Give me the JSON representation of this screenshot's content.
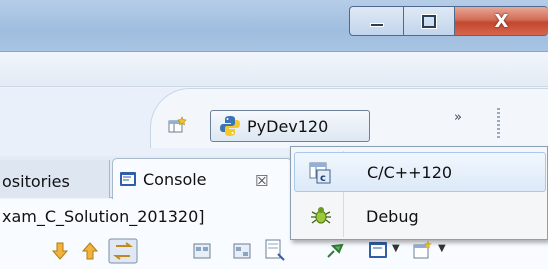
{
  "titlebar": {
    "buttons": [
      {
        "name": "minimize",
        "icon": "minimize-icon"
      },
      {
        "name": "maximize",
        "icon": "restore-icon"
      },
      {
        "name": "close",
        "glyph": "X",
        "color": "#c9503a"
      }
    ]
  },
  "perspective_bar": {
    "open_perspective_icon": "open-perspective-icon",
    "active_perspective": {
      "label": "PyDev120",
      "icon": "python-icon"
    },
    "overflow_glyph": "»"
  },
  "views": {
    "tabs": [
      {
        "label": "ositories",
        "state": "inactive"
      },
      {
        "label": "Console",
        "icon": "console-icon",
        "state": "active",
        "close_glyph": "☒"
      }
    ],
    "console_path": "xam_C_Solution_201320]"
  },
  "perspective_menu": {
    "items": [
      {
        "label": "C/C++120",
        "icon": "cpp-perspective-icon",
        "highlighted": true
      },
      {
        "label": "Debug",
        "icon": "debug-bug-icon",
        "highlighted": false
      }
    ]
  }
}
